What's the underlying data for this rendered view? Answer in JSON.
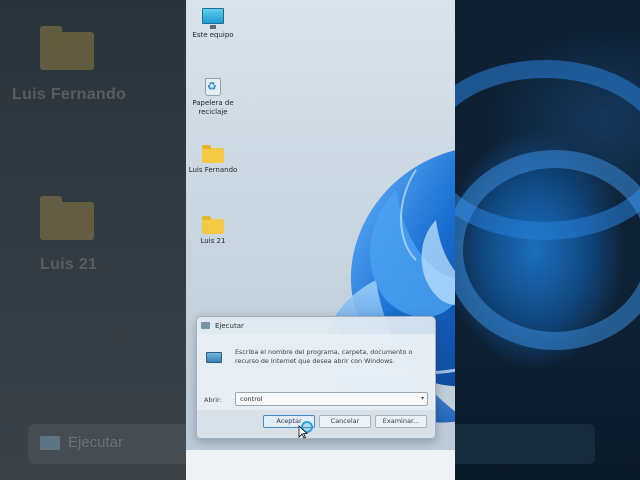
{
  "background_blur": {
    "left_labels": [
      "Luis Fernando",
      "Luis 21"
    ],
    "run_title": "Ejecutar"
  },
  "desktop": {
    "icons": [
      {
        "label": "Este equipo",
        "icon": "computer-icon"
      },
      {
        "label": "Papelera de reciclaje",
        "icon": "recycle-bin-icon"
      },
      {
        "label": "Luis Fernando",
        "icon": "folder-icon"
      },
      {
        "label": "Luis 21",
        "icon": "folder-icon"
      }
    ]
  },
  "run_dialog": {
    "title": "Ejecutar",
    "description": "Escriba el nombre del programa, carpeta, documento o recurso de Internet que desea abrir con Windows.",
    "open_label": "Abrir:",
    "open_value": "control",
    "ok_label": "Aceptar",
    "cancel_label": "Cancelar",
    "browse_label": "Examinar..."
  },
  "colors": {
    "accent": "#1e88c9",
    "folder": "#f4c944",
    "wallpaper_bloom": "#1a6fd1"
  }
}
